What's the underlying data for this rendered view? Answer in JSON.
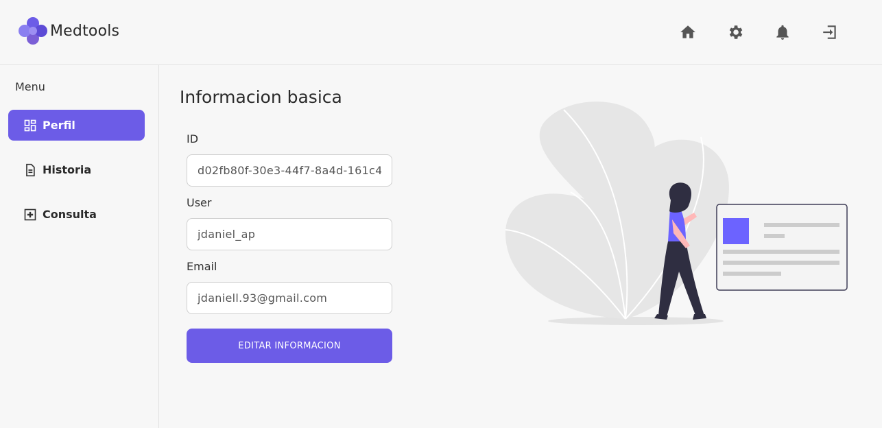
{
  "brand": {
    "name": "Medtools",
    "accent": "#6c5ce7"
  },
  "header": {
    "icons": [
      "home-icon",
      "settings-icon",
      "notifications-icon",
      "logout-icon"
    ]
  },
  "sidebar": {
    "title": "Menu",
    "items": [
      {
        "label": "Perfil",
        "icon": "dashboard-icon",
        "active": true
      },
      {
        "label": "Historia",
        "icon": "document-icon",
        "active": false
      },
      {
        "label": "Consulta",
        "icon": "plus-box-icon",
        "active": false
      }
    ]
  },
  "main": {
    "title": "Informacion basica",
    "fields": [
      {
        "label": "ID",
        "value": "d02fb80f-30e3-44f7-8a4d-161c4"
      },
      {
        "label": "User",
        "value": "jdaniel_ap"
      },
      {
        "label": "Email",
        "value": "jdaniell.93@gmail.com"
      }
    ],
    "button_label": "EDITAR INFORMACION"
  }
}
